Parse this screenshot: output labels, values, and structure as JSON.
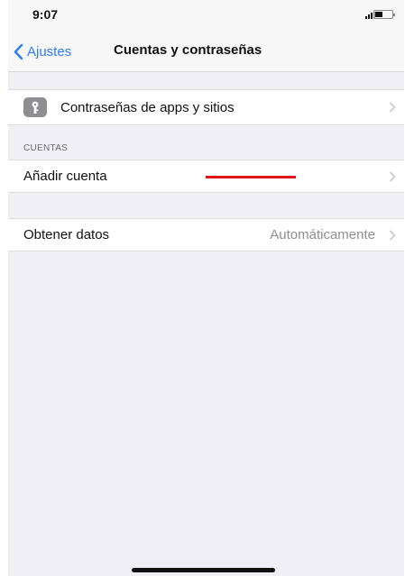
{
  "status_bar": {
    "time": "9:07"
  },
  "nav": {
    "back_label": "Ajustes",
    "title": "Cuentas y contraseñas"
  },
  "passwords_row": {
    "label": "Contraseñas de apps y sitios",
    "icon": "key-icon"
  },
  "accounts_section": {
    "header": "CUENTAS",
    "add_account_label": "Añadir cuenta"
  },
  "fetch_row": {
    "label": "Obtener datos",
    "value": "Automáticamente"
  },
  "colors": {
    "accent": "#2f7cf6",
    "background": "#f0eff5",
    "annotation": "#e01616"
  }
}
